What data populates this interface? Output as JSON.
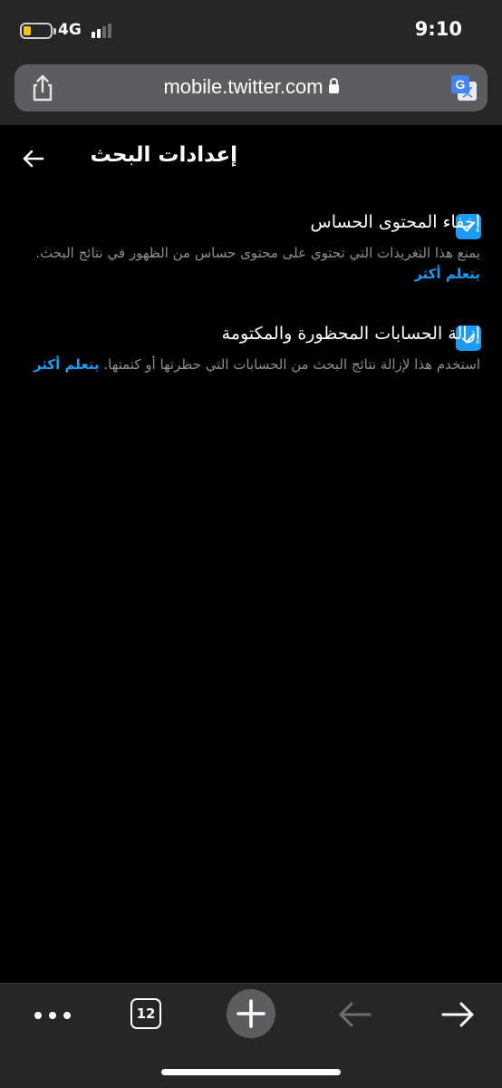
{
  "status_bar": {
    "network": "4G",
    "time": "9:10"
  },
  "browser": {
    "url": "mobile.twitter.com",
    "share_icon": "share-icon",
    "translate_icon": "translate-icon",
    "lock_icon": "lock-icon"
  },
  "header": {
    "title": "إعدادات البحث",
    "back_icon": "back-arrow-icon"
  },
  "settings": [
    {
      "label": "إخفاء المحتوى الحساس",
      "checked": true,
      "description": "يمنع هذا التغريدات التي تحتوي على محتوى حساس من الظهور في نتائج البحث.",
      "link": "يتعلم أكثر"
    },
    {
      "label": "إزالة الحسابات المحظورة والمكتومة",
      "checked": true,
      "description": "استخدم هذا لإزالة نتائج البحث من الحسابات التي حظرتها أو كتمتها.",
      "link": "يتعلم أكثر"
    }
  ],
  "toolbar": {
    "tabs_count": "12",
    "more_icon": "more-dots-icon",
    "new_tab_icon": "plus-icon",
    "back_icon": "back-arrow-icon",
    "forward_icon": "forward-arrow-icon"
  },
  "colors": {
    "accent": "#1d9bf0",
    "background": "#000000",
    "chrome": "#262626",
    "secondary_text": "#8b8d90"
  }
}
